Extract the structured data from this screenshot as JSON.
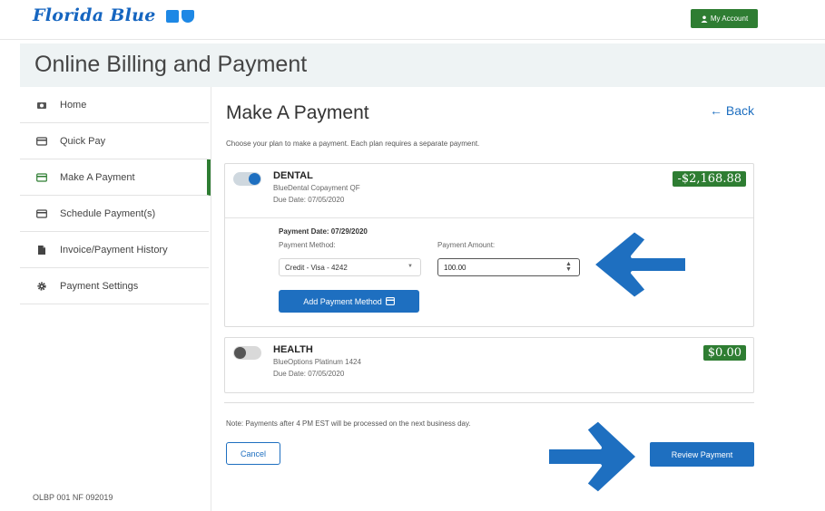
{
  "header": {
    "brand": "Florida Blue",
    "account_button": "My Account"
  },
  "title": "Online Billing and Payment",
  "sidebar": {
    "items": [
      {
        "label": "Home",
        "icon": "home-icon"
      },
      {
        "label": "Quick Pay",
        "icon": "card-icon"
      },
      {
        "label": "Make A Payment",
        "icon": "card-icon",
        "active": true
      },
      {
        "label": "Schedule Payment(s)",
        "icon": "card-icon"
      },
      {
        "label": "Invoice/Payment History",
        "icon": "document-icon"
      },
      {
        "label": "Payment Settings",
        "icon": "gear-icon"
      }
    ],
    "footer_code": "OLBP 001 NF 092019"
  },
  "main": {
    "heading": "Make A Payment",
    "back_label": "← Back",
    "instructions": "Choose your plan to make a payment. Each plan requires a separate payment.",
    "plans": [
      {
        "name": "DENTAL",
        "product": "BlueDental Copayment QF",
        "due_date": "Due Date: 07/05/2020",
        "amount": "-$2,168.88",
        "enabled": true
      },
      {
        "name": "HEALTH",
        "product": "BlueOptions Platinum 1424",
        "due_date": "Due Date: 07/05/2020",
        "amount": "$0.00",
        "enabled": false
      }
    ],
    "payment": {
      "date_label": "Payment Date: 07/29/2020",
      "method_label": "Payment Method:",
      "method_value": "Credit - Visa - 4242",
      "amount_label": "Payment Amount:",
      "amount_value": "100.00",
      "add_method_label": "Add Payment Method"
    },
    "note": "Note: Payments after 4 PM EST will be processed on the next business day.",
    "cancel_label": "Cancel",
    "review_label": "Review Payment"
  },
  "colors": {
    "brand_blue": "#1e6fc0",
    "accent_green": "#2e7d32",
    "title_bg": "#eef3f4"
  }
}
